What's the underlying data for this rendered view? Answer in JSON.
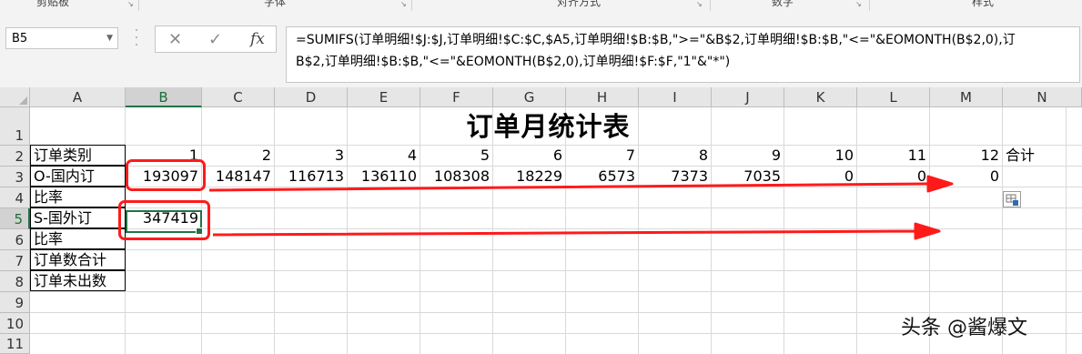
{
  "ribbon": {
    "groups": [
      "剪贴板",
      "字体",
      "对齐方式",
      "数字",
      "样式"
    ]
  },
  "formula_bar": {
    "name_box": "B5",
    "cancel_glyph": "✕",
    "enter_glyph": "✓",
    "fx_label": "fx",
    "formula_line1": "=SUMIFS(订单明细!$J:$J,订单明细!$C:$C,$A5,订单明细!$B:$B,\">=\"&B$2,订单明细!$B:$B,\"<=\"&EOMONTH(B$2,0),订",
    "formula_line2": "B$2,订单明细!$B:$B,\"<=\"&EOMONTH(B$2,0),订单明细!$F:$F,\"1\"&\"*\")"
  },
  "sheet": {
    "columns": [
      "A",
      "B",
      "C",
      "D",
      "E",
      "F",
      "G",
      "H",
      "I",
      "J",
      "K",
      "L",
      "M",
      "N"
    ],
    "rows": [
      "1",
      "2",
      "3",
      "4",
      "5",
      "6",
      "7",
      "8",
      "9",
      "10",
      "11"
    ],
    "selected_cell": "B5",
    "title": "订单月统计表",
    "row2": {
      "label": "订单类别",
      "months": [
        "1",
        "2",
        "3",
        "4",
        "5",
        "6",
        "7",
        "8",
        "9",
        "10",
        "11",
        "12"
      ],
      "total": "合计"
    },
    "row3": {
      "label": "O-国内订",
      "values": [
        "193097",
        "148147",
        "116713",
        "136110",
        "108308",
        "18229",
        "6573",
        "7373",
        "7035",
        "0",
        "0",
        "0"
      ]
    },
    "row4": {
      "label": "比率"
    },
    "row5": {
      "label": "S-国外订",
      "values": [
        "347419"
      ]
    },
    "row6": {
      "label": "比率"
    },
    "row7": {
      "label": "订单数合计"
    },
    "row8": {
      "label": "订单未出数"
    }
  },
  "annotations": {
    "color": "#ff1a1a"
  },
  "watermark": "头条 @酱爆文"
}
